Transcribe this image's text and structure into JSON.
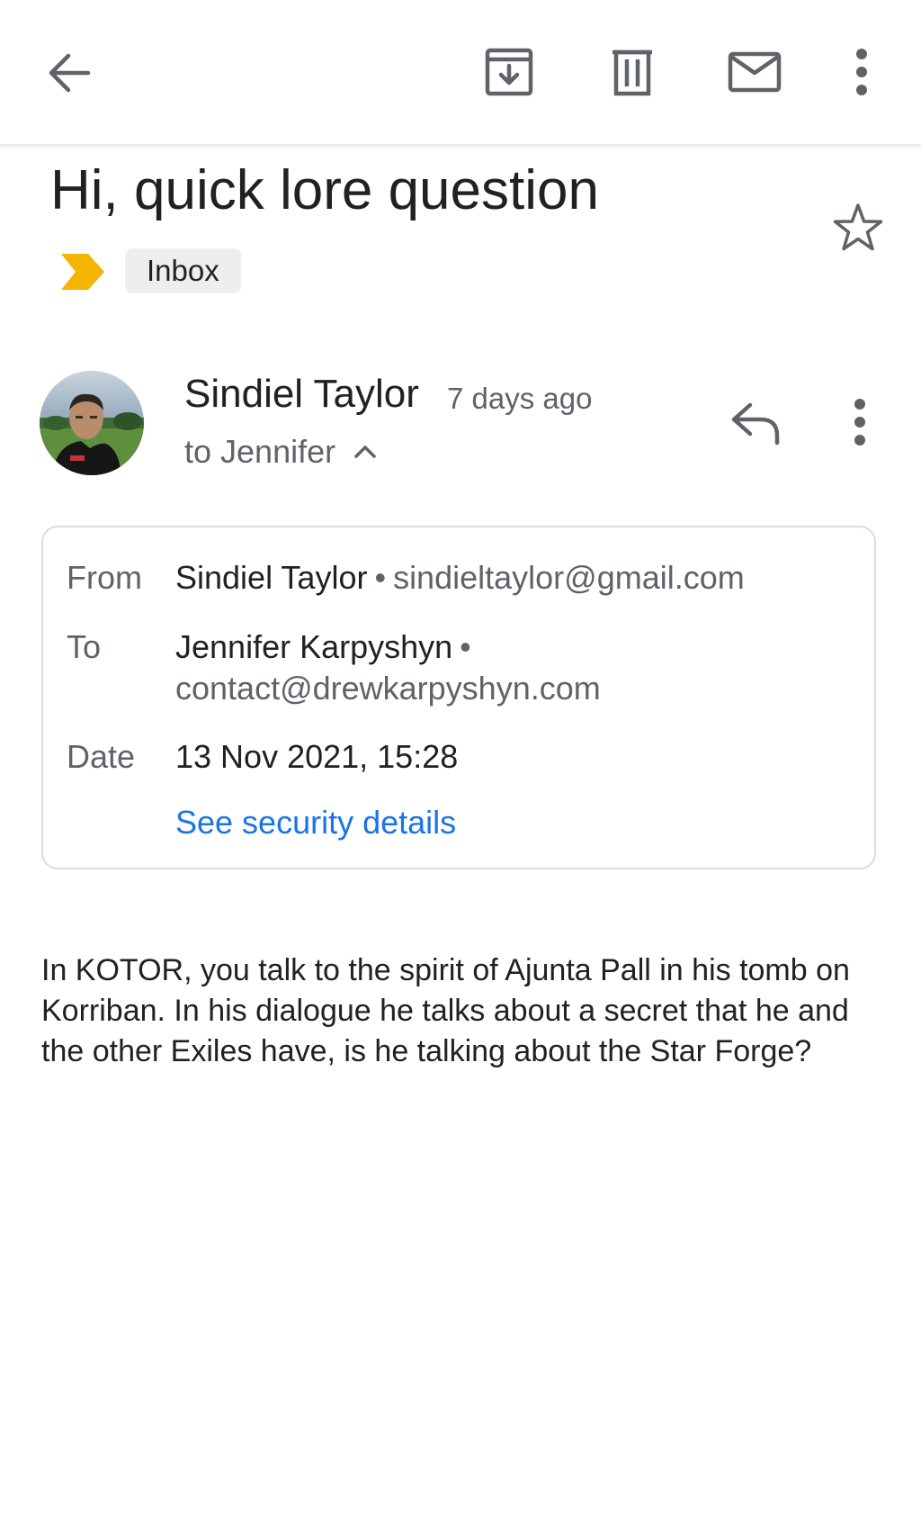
{
  "toolbar": {
    "back_icon": "arrow-left-icon",
    "archive_icon": "archive-icon",
    "delete_icon": "trash-icon",
    "mark_unread_icon": "envelope-icon",
    "more_icon": "more-vert-icon"
  },
  "message": {
    "subject": "Hi, quick lore question",
    "importance_color": "#f4b400",
    "label": "Inbox",
    "sender": {
      "name": "Sindiel Taylor",
      "time": "7 days ago",
      "recipient_line": "to Jennifer"
    },
    "details": {
      "from_label": "From",
      "from_name": "Sindiel Taylor",
      "from_email": "sindieltaylor@gmail.com",
      "to_label": "To",
      "to_name": "Jennifer Karpyshyn",
      "to_email": "contact@drewkarpyshyn.com",
      "date_label": "Date",
      "date_value": "13 Nov 2021, 15:28",
      "security_link": "See security details",
      "separator": "•"
    },
    "body": "In KOTOR, you talk to the spirit of Ajunta Pall in his tomb on Korriban. In his dialogue he talks about a secret that he and the other Exiles have, is he talking about the Star Forge?"
  },
  "colors": {
    "text_primary": "#202124",
    "text_secondary": "#5f6368",
    "link": "#1a73e8",
    "chip_bg": "#eeeeee",
    "card_border": "#dadce0"
  }
}
